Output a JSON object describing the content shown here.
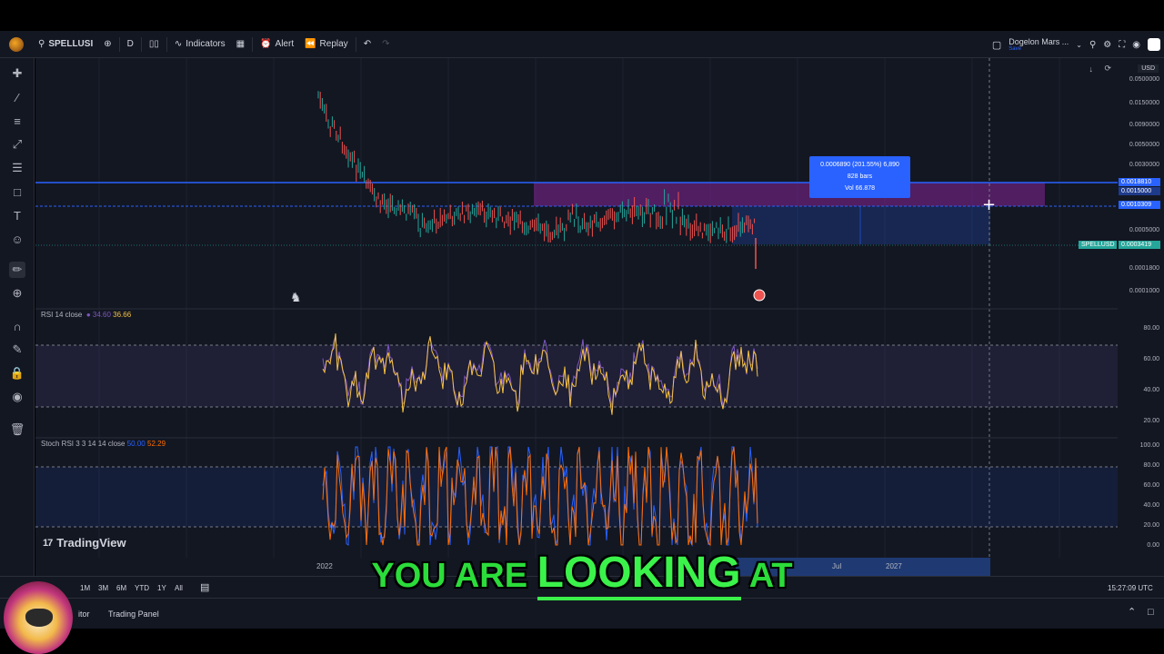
{
  "toolbar": {
    "symbol": "SPELLUSI",
    "interval": "D",
    "indicators": "Indicators",
    "alert": "Alert",
    "replay": "Replay",
    "publish_title": "Dogelon Mars ...",
    "publish_sub": "Save"
  },
  "price_axis": {
    "currency": "USD",
    "ticks": [
      "0.0500000",
      "0.0150000",
      "0.0090000",
      "0.0050000",
      "0.0030000",
      "0.0015000",
      "0.0005000",
      "0.0001800",
      "0.0001000"
    ],
    "tag_blue": "0.0018810",
    "tag_blue2": "0.0010309",
    "tag_green": "0.0003419",
    "symbol_tag": "SPELLUSD"
  },
  "measure": {
    "line1": "0.0006890 (201.55%) 6,890",
    "line2": "828 bars",
    "line3": "Vol 66.878"
  },
  "rsi": {
    "label": "RSI 14 close",
    "v1": "34.60",
    "v2": "36.66",
    "ticks": [
      "80.00",
      "60.00",
      "40.00",
      "20.00"
    ]
  },
  "stoch": {
    "label": "Stoch RSI 3 3 14 14 close",
    "v1": "50.00",
    "v2": "52.29",
    "ticks": [
      "100.00",
      "80.00",
      "60.00",
      "40.00",
      "20.00",
      "0.00"
    ]
  },
  "time_axis": {
    "t2022": "2022",
    "tjul": "Jul",
    "t2027": "2027"
  },
  "range_bar": {
    "ranges": [
      "1M",
      "3M",
      "6M",
      "YTD",
      "1Y",
      "All"
    ],
    "time": "15:27:09 UTC"
  },
  "panel_bar": {
    "editor": "itor",
    "trading_panel": "Trading Panel"
  },
  "brand": "TradingView",
  "subtitle": {
    "part1": "YOU ARE ",
    "part2": "LOOKING",
    "part3": " AT"
  },
  "colors": {
    "bg": "#131722",
    "blue": "#2962ff",
    "green": "#26a69a",
    "red": "#ef5350",
    "purple_zone": "#9c27b0",
    "subtitle": "#2bdc3a"
  }
}
